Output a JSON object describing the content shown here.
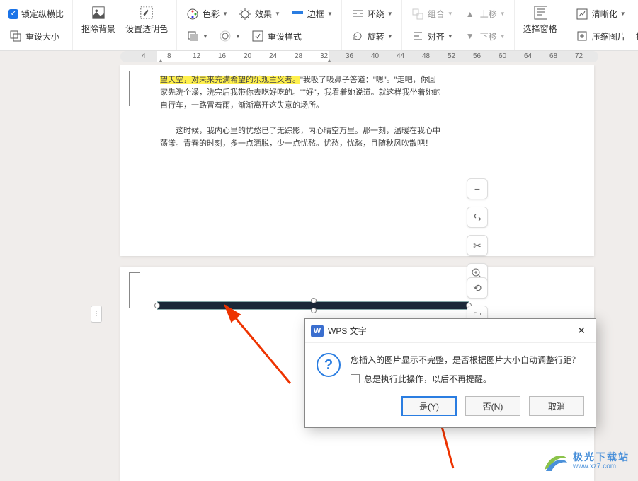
{
  "ribbon": {
    "lock_aspect": "锁定纵横比",
    "reset_size": "重设大小",
    "remove_bg": "抠除背景",
    "set_transparent": "设置透明色",
    "color": "色彩",
    "effects": "效果",
    "border": "边框",
    "reset_style": "重设样式",
    "wrap": "环绕",
    "rotate": "旋转",
    "align": "对齐",
    "group": "组合",
    "move_up": "上移",
    "move_down": "下移",
    "select_pane": "选择窗格",
    "clarity": "清晰化",
    "compress": "压缩图片",
    "batch": "批"
  },
  "ruler_ticks": [
    "4",
    "8",
    "12",
    "16",
    "20",
    "24",
    "28",
    "32",
    "36",
    "40",
    "44",
    "48",
    "52",
    "56",
    "60",
    "64",
    "68",
    "72"
  ],
  "document": {
    "highlighted": "望天空，对未来充满希望的乐观主义者。",
    "p1_rest": "\"我吸了吸鼻子答道：\"嗯\"。\"走吧，你回家先洗个澡，洗完后我带你去吃好吃的。\"\"好\"，我看着她说道。就这样我坐着她的自行车，一路冒着雨，渐渐离开这失意的场所。",
    "p2": "这时候，我内心里的忧愁已了无踪影，内心晴空万里。那一刻，温暖在我心中荡漾。青春的时刻，多一点洒脱，少一点忧愁。忧愁，忧愁，且随秋风吹散吧！"
  },
  "dialog": {
    "title": "WPS 文字",
    "message": "您插入的图片显示不完整，是否根据图片大小自动调整行距？",
    "checkbox": "总是执行此操作，以后不再提醒。",
    "yes": "是(Y)",
    "no": "否(N)",
    "cancel": "取消"
  },
  "watermark": {
    "chinese": "极光下载站",
    "url": "www.xz7.com"
  }
}
